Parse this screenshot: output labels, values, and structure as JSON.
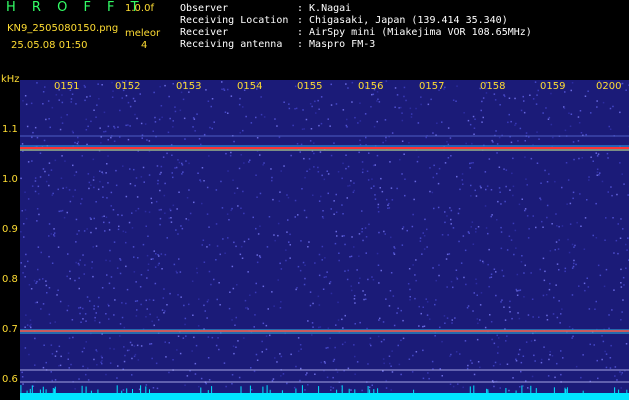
{
  "header": {
    "brand": "H R O F F T",
    "version": "1.0.0f",
    "filename": "KN9_2505080150.png",
    "mode": "meleor",
    "datetime": "25.05.08 01:50",
    "count": "4"
  },
  "info": [
    {
      "label": "Observer",
      "value": ": K.Nagai"
    },
    {
      "label": "Receiving Location",
      "value": ": Chigasaki, Japan (139.414 35.340)"
    },
    {
      "label": "Receiver",
      "value": ": AirSpy mini (Miakejima VOR 108.65MHz)"
    },
    {
      "label": "Receiving antenna",
      "value": ": Maspro FM-3"
    }
  ],
  "y_unit": "kHz",
  "y_ticks": [
    "1.1",
    "1.0",
    "0.9",
    "0.8",
    "0.7",
    "0.6"
  ],
  "x_ticks": [
    "0151",
    "0152",
    "0153",
    "0154",
    "0155",
    "0156",
    "0157",
    "0158",
    "0159",
    "0200"
  ],
  "colors": {
    "background": "#000000",
    "waterfall": "#1b1b78",
    "tick_label": "#ffdd33",
    "brand": "#33ff66",
    "carrier": "#ff3333",
    "floor": "#00e5ff"
  }
}
